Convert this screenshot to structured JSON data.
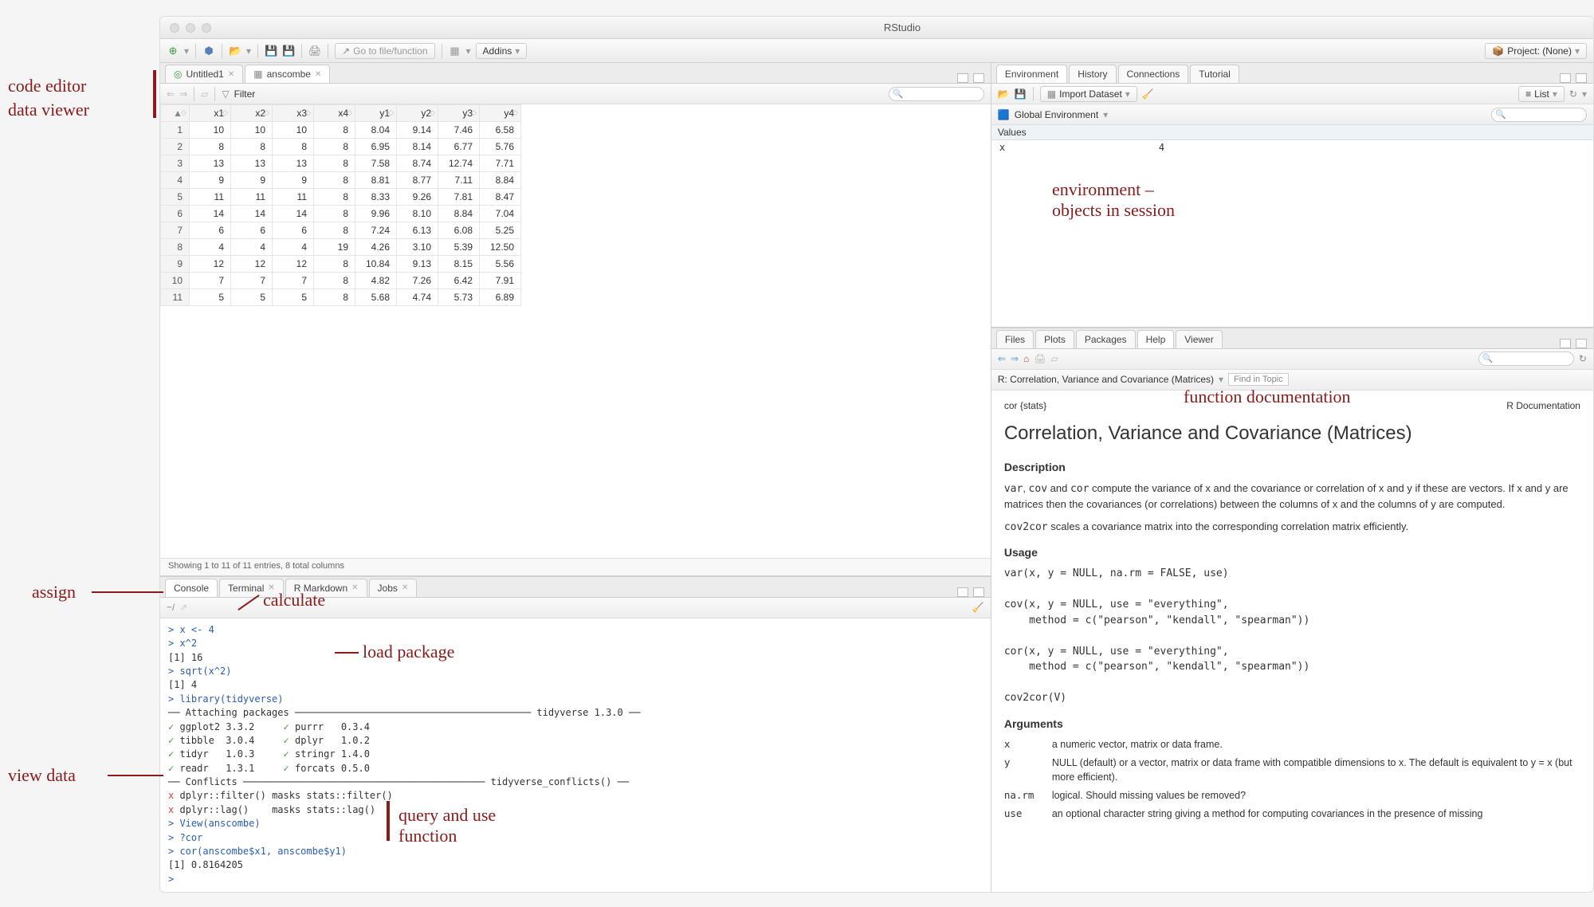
{
  "app": {
    "title": "RStudio"
  },
  "toolbar": {
    "goto_placeholder": "Go to file/function",
    "addins": "Addins",
    "project_label": "Project: (None)"
  },
  "source": {
    "tabs": [
      {
        "label": "Untitled1",
        "icon": "r-script"
      },
      {
        "label": "anscombe",
        "icon": "table"
      }
    ],
    "filter_label": "Filter",
    "table": {
      "headers": [
        "",
        "x1",
        "x2",
        "x3",
        "x4",
        "y1",
        "y2",
        "y3",
        "y4"
      ],
      "rows": [
        [
          "1",
          "10",
          "10",
          "10",
          "8",
          "8.04",
          "9.14",
          "7.46",
          "6.58"
        ],
        [
          "2",
          "8",
          "8",
          "8",
          "8",
          "6.95",
          "8.14",
          "6.77",
          "5.76"
        ],
        [
          "3",
          "13",
          "13",
          "13",
          "8",
          "7.58",
          "8.74",
          "12.74",
          "7.71"
        ],
        [
          "4",
          "9",
          "9",
          "9",
          "8",
          "8.81",
          "8.77",
          "7.11",
          "8.84"
        ],
        [
          "5",
          "11",
          "11",
          "11",
          "8",
          "8.33",
          "9.26",
          "7.81",
          "8.47"
        ],
        [
          "6",
          "14",
          "14",
          "14",
          "8",
          "9.96",
          "8.10",
          "8.84",
          "7.04"
        ],
        [
          "7",
          "6",
          "6",
          "6",
          "8",
          "7.24",
          "6.13",
          "6.08",
          "5.25"
        ],
        [
          "8",
          "4",
          "4",
          "4",
          "19",
          "4.26",
          "3.10",
          "5.39",
          "12.50"
        ],
        [
          "9",
          "12",
          "12",
          "12",
          "8",
          "10.84",
          "9.13",
          "8.15",
          "5.56"
        ],
        [
          "10",
          "7",
          "7",
          "7",
          "8",
          "4.82",
          "7.26",
          "6.42",
          "7.91"
        ],
        [
          "11",
          "5",
          "5",
          "5",
          "8",
          "5.68",
          "4.74",
          "5.73",
          "6.89"
        ]
      ],
      "status": "Showing 1 to 11 of 11 entries, 8 total columns"
    }
  },
  "console": {
    "tabs": [
      "Console",
      "Terminal",
      "R Markdown",
      "Jobs"
    ],
    "cwd": "~/",
    "lines": {
      "l1": "> x <- 4",
      "l2": "> x^2",
      "l3": "[1] 16",
      "l4": "> sqrt(x^2)",
      "l5": "[1] 4",
      "l6": "> library(tidyverse)",
      "attach": "── Attaching packages ───────────────────────────────────────── tidyverse 1.3.0 ──",
      "p1a": "ggplot2",
      "p1b": "3.3.2",
      "p1c": "purrr",
      "p1d": "0.3.4",
      "p2a": "tibble",
      "p2b": "3.0.4",
      "p2c": "dplyr",
      "p2d": "1.0.2",
      "p3a": "tidyr",
      "p3b": "1.0.3",
      "p3c": "stringr",
      "p3d": "1.4.0",
      "p4a": "readr",
      "p4b": "1.3.1",
      "p4c": "forcats",
      "p4d": "0.5.0",
      "conflicts": "── Conflicts ────────────────────────────────────────── tidyverse_conflicts() ──",
      "c1": "dplyr::filter() masks stats::filter()",
      "c2": "dplyr::lag()    masks stats::lag()",
      "l7": "> View(anscombe)",
      "l8": "> ?cor",
      "l9": "> cor(anscombe$x1, anscombe$y1)",
      "l10": "[1] 0.8164205",
      "l11": "> "
    }
  },
  "env": {
    "tabs": [
      "Environment",
      "History",
      "Connections",
      "Tutorial"
    ],
    "import_label": "Import Dataset",
    "list_label": "List",
    "scope": "Global Environment",
    "section": "Values",
    "rows": [
      {
        "name": "x",
        "value": "4"
      }
    ]
  },
  "help": {
    "tabs": [
      "Files",
      "Plots",
      "Packages",
      "Help",
      "Viewer"
    ],
    "breadcrumb": "R: Correlation, Variance and Covariance (Matrices)",
    "find_label": "Find in Topic",
    "pkg": "cor {stats}",
    "doc_label": "R Documentation",
    "title": "Correlation, Variance and Covariance (Matrices)",
    "h_desc": "Description",
    "desc1_a": "var",
    "desc1_b": "cov",
    "desc1_c": "cor",
    "desc1": " compute the variance of x and the covariance or correlation of x and y if these are vectors. If x and y are matrices then the covariances (or correlations) between the columns of x and the columns of y are computed.",
    "desc2_a": "cov2cor",
    "desc2": " scales a covariance matrix into the corresponding correlation matrix efficiently.",
    "h_usage": "Usage",
    "usage": "var(x, y = NULL, na.rm = FALSE, use)\n\ncov(x, y = NULL, use = \"everything\",\n    method = c(\"pearson\", \"kendall\", \"spearman\"))\n\ncor(x, y = NULL, use = \"everything\",\n    method = c(\"pearson\", \"kendall\", \"spearman\"))\n\ncov2cor(V)",
    "h_args": "Arguments",
    "args": [
      {
        "n": "x",
        "d": "a numeric vector, matrix or data frame."
      },
      {
        "n": "y",
        "d": "NULL (default) or a vector, matrix or data frame with compatible dimensions to x. The default is equivalent to y = x (but more efficient)."
      },
      {
        "n": "na.rm",
        "d": "logical. Should missing values be removed?"
      },
      {
        "n": "use",
        "d": "an optional character string giving a method for computing covariances in the presence of missing"
      }
    ]
  },
  "annotations": {
    "code_editor": "code editor",
    "data_viewer": "data viewer",
    "assign": "assign",
    "calculate": "calculate",
    "load_package": "load package",
    "view_data": "view data",
    "query_use": "query and use\nfunction",
    "env": "environment –\nobjects in session",
    "fn_doc": "function documentation"
  }
}
